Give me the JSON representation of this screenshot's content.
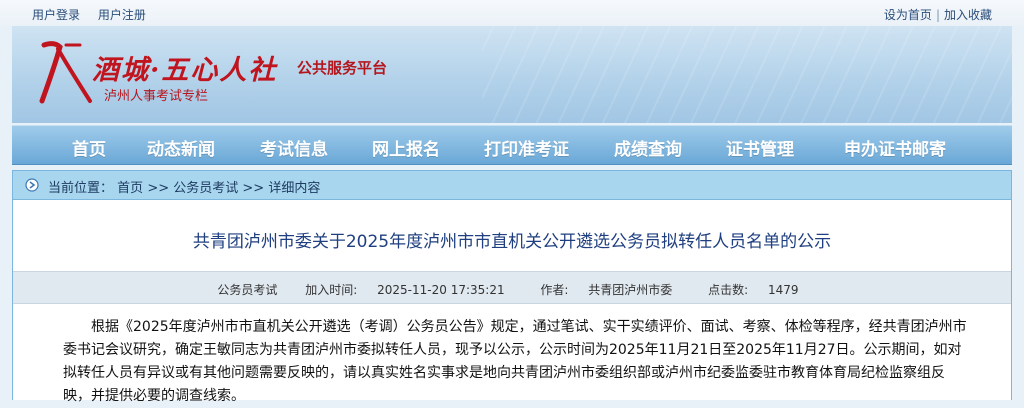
{
  "topbar": {
    "login": "用户登录",
    "register": "用户注册",
    "set_home": "设为首页",
    "separator": "|",
    "bookmark": "加入收藏"
  },
  "banner": {
    "brand_title": "酒城·五心人社",
    "brand_subtitle": "公共服务平台",
    "brand_tagline": "泸州人事考试专栏",
    "brand_color": "#c0141e"
  },
  "nav": {
    "items": [
      {
        "label": "首页"
      },
      {
        "label": "动态新闻"
      },
      {
        "label": "考试信息"
      },
      {
        "label": "网上报名"
      },
      {
        "label": "打印准考证"
      },
      {
        "label": "成绩查询"
      },
      {
        "label": "证书管理"
      },
      {
        "label": "申办证书邮寄"
      }
    ]
  },
  "breadcrumb": {
    "prefix": "当前位置：",
    "home": "首页",
    "sep1": ">>",
    "category": "公务员考试",
    "sep2": ">>",
    "current": "详细内容"
  },
  "article": {
    "title": "共青团泸州市委关于2025年度泸州市市直机关公开遴选公务员拟转任人员名单的公示",
    "category": "公务员考试",
    "added_time_label": "加入时间:",
    "added_time": "2025-11-20 17:35:21",
    "author_label": "作者:",
    "author": "共青团泸州市委",
    "hits_label": "点击数:",
    "hits": "1479",
    "body": "根据《2025年度泸州市市直机关公开遴选（考调）公务员公告》规定，通过笔试、实干实绩评价、面试、考察、体检等程序，经共青团泸州市委书记会议研究，确定王敏同志为共青团泸州市委拟转任人员，现予以公示，公示时间为2025年11月21日至2025年11月27日。公示期间，如对拟转任人员有异议或有其他问题需要反映的，请以真实姓名实事求是地向共青团泸州市委组织部或泸州市纪委监委驻市教育体育局纪检监察组反映，并提供必要的调查线索。"
  }
}
